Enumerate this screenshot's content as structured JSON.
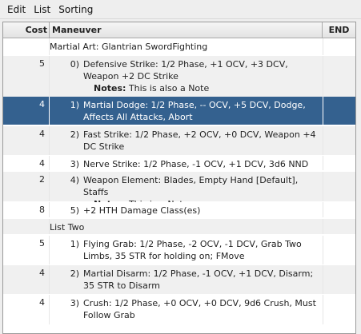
{
  "menu": [
    "Edit",
    "List",
    "Sorting"
  ],
  "columns": {
    "cost": "Cost",
    "maneuver": "Maneuver",
    "end": "END"
  },
  "rows": [
    {
      "type": "group",
      "title": "Martial Art: Glantrian SwordFighting"
    },
    {
      "type": "item",
      "cost": "5",
      "num": "0)",
      "text": "Defensive Strike: 1/2 Phase, +1 OCV, +3 DCV, Weapon +2 DC Strike",
      "note_label": "Notes:",
      "note": "This is also a Note"
    },
    {
      "type": "item",
      "cost": "4",
      "num": "1)",
      "text": "Martial Dodge: 1/2 Phase, -- OCV, +5 DCV, Dodge, Affects All Attacks, Abort",
      "selected": true
    },
    {
      "type": "item",
      "cost": "4",
      "num": "2)",
      "text": "Fast Strike: 1/2 Phase, +2 OCV, +0 DCV, Weapon +4 DC Strike"
    },
    {
      "type": "item",
      "cost": "4",
      "num": "3)",
      "text": "Nerve Strike: 1/2 Phase, -1 OCV, +1 DCV, 3d6 NND"
    },
    {
      "type": "item",
      "cost": "2",
      "num": "4)",
      "text": "Weapon Element: Blades, Empty Hand [Default], Staffs",
      "note_label": "Notes:",
      "note": "This is a Note"
    },
    {
      "type": "item",
      "cost": "8",
      "num": "5)",
      "text": "+2 HTH Damage Class(es)"
    },
    {
      "type": "group",
      "title": "List Two"
    },
    {
      "type": "item",
      "cost": "5",
      "num": "1)",
      "text": "Flying Grab: 1/2 Phase, -2 OCV, -1 DCV, Grab Two Limbs, 35 STR for holding on; FMove"
    },
    {
      "type": "item",
      "cost": "4",
      "num": "2)",
      "text": "Martial Disarm: 1/2 Phase, -1 OCV, +1 DCV, Disarm; 35 STR to Disarm"
    },
    {
      "type": "item",
      "cost": "4",
      "num": "3)",
      "text": "Crush: 1/2 Phase, +0 OCV, +0 DCV, 9d6 Crush, Must Follow Grab"
    }
  ]
}
